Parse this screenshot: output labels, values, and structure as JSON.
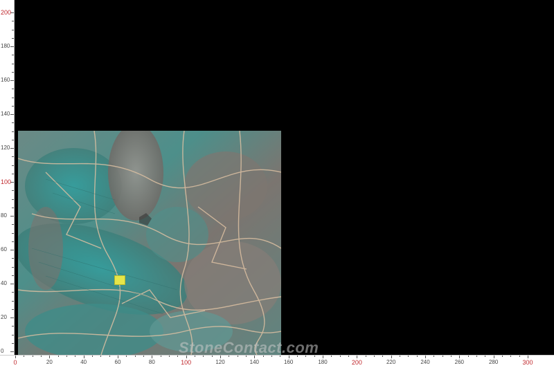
{
  "image": {
    "description_subject": "stone slab",
    "background_color": "#000000",
    "stone_colors": [
      "#3f8f8a",
      "#5aa8a0",
      "#7a716c",
      "#9b8f88",
      "#d9b89a"
    ]
  },
  "ruler_left": {
    "labels": [
      {
        "text": "0",
        "major": false
      },
      {
        "text": "20",
        "major": false
      },
      {
        "text": "40",
        "major": false
      },
      {
        "text": "60",
        "major": false
      },
      {
        "text": "80",
        "major": false
      },
      {
        "text": "100",
        "major": true
      },
      {
        "text": "120",
        "major": false
      },
      {
        "text": "140",
        "major": false
      },
      {
        "text": "160",
        "major": false
      },
      {
        "text": "180",
        "major": false
      },
      {
        "text": "200",
        "major": true
      }
    ]
  },
  "ruler_bottom": {
    "labels": [
      {
        "text": "0",
        "major": true
      },
      {
        "text": "20",
        "major": false
      },
      {
        "text": "40",
        "major": false
      },
      {
        "text": "60",
        "major": false
      },
      {
        "text": "80",
        "major": false
      },
      {
        "text": "100",
        "major": true
      },
      {
        "text": "120",
        "major": false
      },
      {
        "text": "140",
        "major": false
      },
      {
        "text": "160",
        "major": false
      },
      {
        "text": "180",
        "major": false
      },
      {
        "text": "200",
        "major": true
      },
      {
        "text": "220",
        "major": false
      },
      {
        "text": "240",
        "major": false
      },
      {
        "text": "260",
        "major": false
      },
      {
        "text": "280",
        "major": false
      },
      {
        "text": "300",
        "major": true
      }
    ]
  },
  "watermark": {
    "text": "StoneContact.com"
  }
}
